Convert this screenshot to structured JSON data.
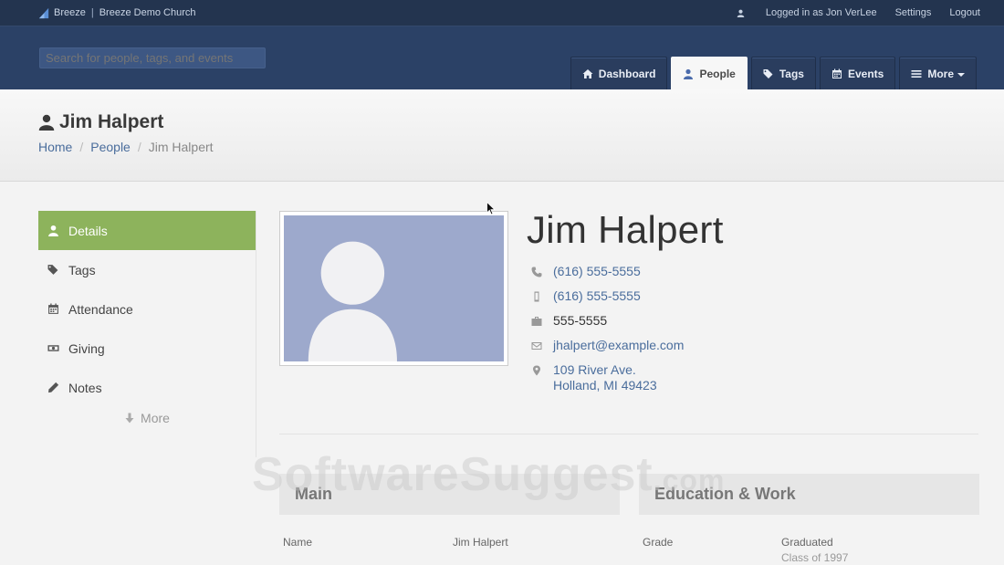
{
  "topbar": {
    "brand": "Breeze",
    "org": "Breeze Demo Church",
    "user_label": "Logged in as Jon VerLee",
    "settings": "Settings",
    "logout": "Logout"
  },
  "search": {
    "placeholder": "Search for people, tags, and events"
  },
  "tabs": [
    {
      "label": "Dashboard",
      "icon": "home-icon"
    },
    {
      "label": "People",
      "icon": "user-icon",
      "active": true
    },
    {
      "label": "Tags",
      "icon": "tags-icon"
    },
    {
      "label": "Events",
      "icon": "calendar-icon"
    },
    {
      "label": "More",
      "icon": "menu-icon"
    }
  ],
  "page": {
    "title": "Jim Halpert",
    "breadcrumb": [
      "Home",
      "People",
      "Jim Halpert"
    ]
  },
  "sidebar": {
    "items": [
      {
        "label": "Details",
        "icon": "user-icon",
        "active": true
      },
      {
        "label": "Tags",
        "icon": "tags-icon"
      },
      {
        "label": "Attendance",
        "icon": "calendar-icon"
      },
      {
        "label": "Giving",
        "icon": "money-icon"
      },
      {
        "label": "Notes",
        "icon": "pencil-icon"
      }
    ],
    "more": "More"
  },
  "profile": {
    "name": "Jim Halpert",
    "home_phone": "(616) 555-5555",
    "mobile_phone": "(616) 555-5555",
    "work_phone": "555-5555",
    "email": "jhalpert@example.com",
    "address_line1": "109 River Ave.",
    "address_line2": "Holland, MI 49423"
  },
  "sections": {
    "main": {
      "title": "Main",
      "rows": [
        {
          "label": "Name",
          "value": "Jim Halpert"
        }
      ]
    },
    "education": {
      "title": "Education & Work",
      "rows": [
        {
          "label": "Grade",
          "value": "Graduated",
          "sub": "Class of 1997"
        }
      ]
    }
  },
  "watermark": {
    "text": "SoftwareSuggest",
    "suffix": ".com"
  },
  "colors": {
    "topbar": "#23344f",
    "header": "#2b4166",
    "accent_green": "#8db35c",
    "link_blue": "#4a6d9c",
    "photo_bg": "#9da9cc"
  }
}
